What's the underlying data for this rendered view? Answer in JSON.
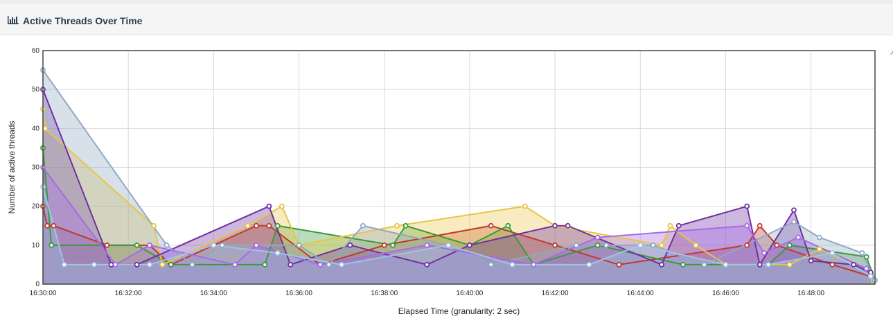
{
  "panel": {
    "title": "Active Threads Over Time",
    "icon": "bar-chart-icon"
  },
  "colors": {
    "series": [
      "#c0392b",
      "#3a9a3a",
      "#e8c547",
      "#7030a0",
      "#8fa9c4",
      "#a56be8",
      "#9fc5e8"
    ]
  },
  "chart_data": {
    "type": "area",
    "xlabel": "Elapsed Time (granularity: 2 sec)",
    "ylabel": "Number of active threads",
    "ylim": [
      0,
      60
    ],
    "y_ticks": [
      "0",
      "10",
      "20",
      "30",
      "40",
      "50",
      "60"
    ],
    "x_ticks": [
      "16:30:00",
      "16:32:00",
      "16:34:00",
      "16:36:00",
      "16:38:00",
      "16:40:00",
      "16:42:00",
      "16:44:00",
      "16:46:00",
      "16:48:00"
    ],
    "xlim_minutes": [
      0,
      19.5
    ],
    "grid": true,
    "series": [
      {
        "points": [
          [
            0.0,
            20
          ],
          [
            0.1,
            15
          ],
          [
            0.25,
            15
          ],
          [
            1.5,
            10
          ],
          [
            2.5,
            10
          ],
          [
            3.0,
            5
          ],
          [
            5.0,
            15
          ],
          [
            5.3,
            15
          ],
          [
            6.5,
            5
          ],
          [
            8.0,
            10
          ],
          [
            10.5,
            15
          ],
          [
            12.0,
            10
          ],
          [
            13.5,
            5
          ],
          [
            16.5,
            10
          ],
          [
            16.8,
            15
          ],
          [
            17.2,
            10
          ],
          [
            18.5,
            5
          ],
          [
            19.4,
            2
          ]
        ]
      },
      {
        "points": [
          [
            0.0,
            35
          ],
          [
            0.2,
            10
          ],
          [
            2.2,
            10
          ],
          [
            3.0,
            5
          ],
          [
            5.2,
            5
          ],
          [
            5.5,
            15
          ],
          [
            8.2,
            10
          ],
          [
            8.5,
            15
          ],
          [
            10.0,
            10
          ],
          [
            10.9,
            15
          ],
          [
            11.5,
            5
          ],
          [
            13.0,
            10
          ],
          [
            15.0,
            5
          ],
          [
            17.0,
            5
          ],
          [
            17.5,
            10
          ],
          [
            19.3,
            7
          ],
          [
            19.5,
            1
          ]
        ]
      },
      {
        "points": [
          [
            0.0,
            45
          ],
          [
            0.05,
            40
          ],
          [
            2.6,
            15
          ],
          [
            2.8,
            5
          ],
          [
            4.8,
            15
          ],
          [
            5.6,
            20
          ],
          [
            6.0,
            10
          ],
          [
            8.3,
            15
          ],
          [
            11.3,
            20
          ],
          [
            12.0,
            15
          ],
          [
            14.5,
            10
          ],
          [
            14.7,
            15
          ],
          [
            15.3,
            10
          ],
          [
            16.0,
            5
          ],
          [
            17.5,
            5
          ],
          [
            18.2,
            9
          ],
          [
            19.4,
            3
          ]
        ]
      },
      {
        "points": [
          [
            0.0,
            50
          ],
          [
            1.6,
            5
          ],
          [
            2.2,
            5
          ],
          [
            5.3,
            20
          ],
          [
            5.8,
            5
          ],
          [
            7.2,
            10
          ],
          [
            9.0,
            5
          ],
          [
            10.0,
            10
          ],
          [
            12.0,
            15
          ],
          [
            12.3,
            15
          ],
          [
            14.5,
            5
          ],
          [
            14.9,
            15
          ],
          [
            16.5,
            20
          ],
          [
            16.8,
            5
          ],
          [
            17.6,
            19
          ],
          [
            18.0,
            6
          ],
          [
            19.0,
            5
          ],
          [
            19.4,
            3
          ]
        ]
      },
      {
        "points": [
          [
            0.0,
            55
          ],
          [
            2.9,
            10
          ],
          [
            3.5,
            5
          ],
          [
            4.2,
            10
          ],
          [
            6.0,
            10
          ],
          [
            6.7,
            5
          ],
          [
            7.5,
            15
          ],
          [
            9.5,
            10
          ],
          [
            10.5,
            5
          ],
          [
            12.5,
            10
          ],
          [
            13.2,
            10
          ],
          [
            14.3,
            10
          ],
          [
            15.5,
            5
          ],
          [
            17.6,
            16
          ],
          [
            18.2,
            12
          ],
          [
            19.2,
            8
          ],
          [
            19.5,
            1
          ]
        ]
      },
      {
        "points": [
          [
            0.0,
            30
          ],
          [
            1.7,
            5
          ],
          [
            2.5,
            10
          ],
          [
            4.5,
            5
          ],
          [
            5.0,
            10
          ],
          [
            6.5,
            5
          ],
          [
            9.0,
            10
          ],
          [
            11.5,
            5
          ],
          [
            13.0,
            12
          ],
          [
            16.5,
            15
          ],
          [
            16.9,
            8
          ],
          [
            17.7,
            12
          ],
          [
            19.3,
            4
          ]
        ]
      },
      {
        "points": [
          [
            0.0,
            25
          ],
          [
            0.5,
            5
          ],
          [
            1.2,
            5
          ],
          [
            2.5,
            5
          ],
          [
            4.0,
            10
          ],
          [
            5.5,
            8
          ],
          [
            7.0,
            5
          ],
          [
            9.5,
            10
          ],
          [
            11.0,
            5
          ],
          [
            12.8,
            5
          ],
          [
            14.0,
            10
          ],
          [
            16.0,
            5
          ],
          [
            17.0,
            5
          ],
          [
            18.5,
            8
          ],
          [
            19.4,
            2
          ]
        ]
      }
    ]
  }
}
